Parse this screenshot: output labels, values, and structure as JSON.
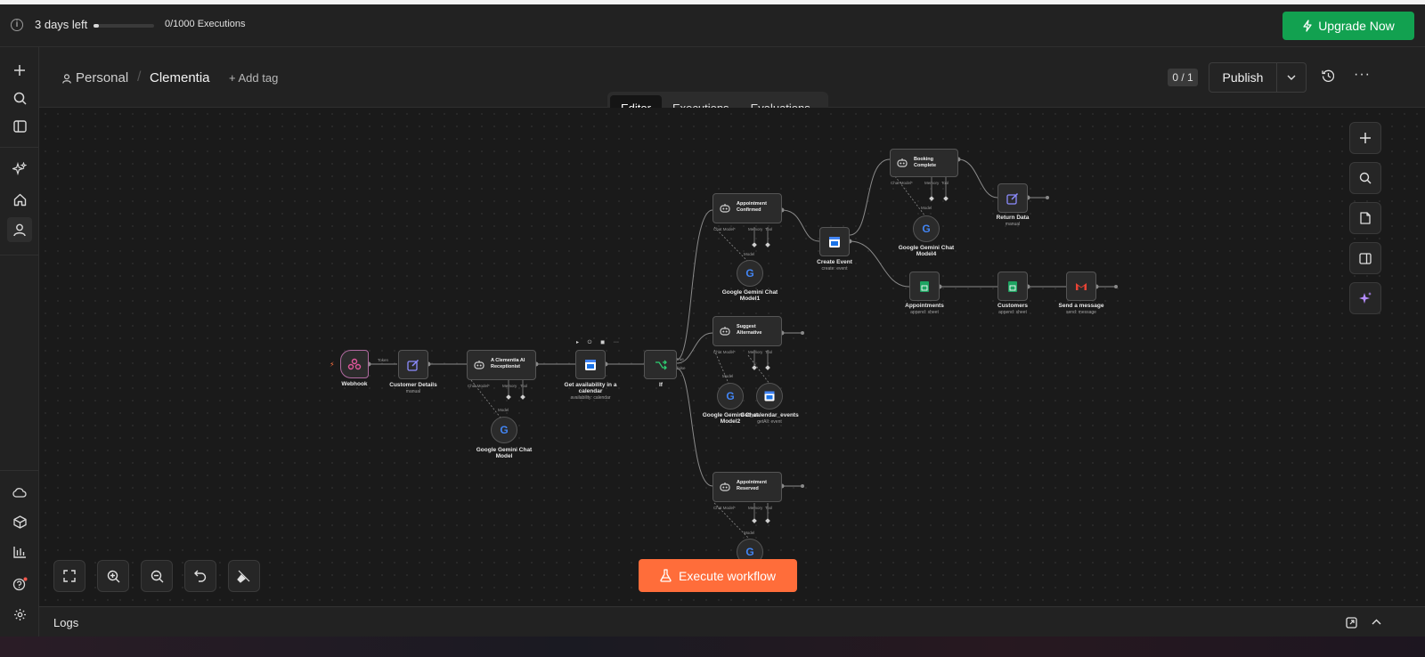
{
  "trial": {
    "days_left": "3 days left",
    "executions": "0/1000 Executions",
    "progress": 0.02
  },
  "upgrade_label": "Upgrade Now",
  "breadcrumb": {
    "project": "Personal",
    "workflow": "Clementia",
    "add_tag": "+ Add tag"
  },
  "tabs": [
    {
      "label": "Editor",
      "active": true
    },
    {
      "label": "Executions",
      "active": false
    },
    {
      "label": "Evaluations",
      "active": false
    }
  ],
  "version_badge": "0 / 1",
  "publish_label": "Publish",
  "execute_label": "Execute workflow",
  "logs_label": "Logs",
  "colors": {
    "upgrade": "#12a150",
    "execute": "#ff6d3a",
    "background": "#1c1c1c"
  },
  "nodes": {
    "webhook": {
      "label": "Webhook"
    },
    "customer_details": {
      "label": "Customer Details",
      "sub": "manual"
    },
    "receptionist": {
      "line1": "A Clementia AI",
      "line2": "Receptionist"
    },
    "get_availability": {
      "line1": "Get availability in a",
      "line2": "calendar",
      "sub": "availability: calendar"
    },
    "if_node": {
      "label": "If",
      "true_label": "true",
      "false_label": "false"
    },
    "gemini_model": {
      "line1": "Google Gemini Chat",
      "line2": "Model"
    },
    "appt_confirmed": {
      "line1": "Appointment",
      "line2": "Confirmed"
    },
    "gemini_model1": {
      "line1": "Google Gemini Chat",
      "line2": "Model1"
    },
    "create_event": {
      "label": "Create Event",
      "sub": "create: event"
    },
    "booking_complete": {
      "line1": "Booking",
      "line2": "Complete"
    },
    "gemini_model4": {
      "line1": "Google Gemini Chat",
      "line2": "Model4"
    },
    "return_data": {
      "label": "Return Data",
      "sub": "manual"
    },
    "appointments": {
      "label": "Appointments",
      "sub": "append: sheet"
    },
    "customers": {
      "label": "Customers",
      "sub": "append: sheet"
    },
    "send_message": {
      "label": "Send a message",
      "sub": "send: message"
    },
    "suggest_alt": {
      "line1": "Suggest",
      "line2": "Alternative"
    },
    "gemini_model2": {
      "line1": "Google Gemini Chat",
      "line2": "Model2"
    },
    "calendar_events": {
      "label": "Get_calendar_events",
      "sub": "getAll: event"
    },
    "appt_reserved": {
      "line1": "Appointment",
      "line2": "Reserved"
    }
  },
  "ports": {
    "chat_model": "Chat Model*",
    "memory": "Memory",
    "tool": "Tool",
    "model": "Model",
    "webhook_out": "Token"
  }
}
